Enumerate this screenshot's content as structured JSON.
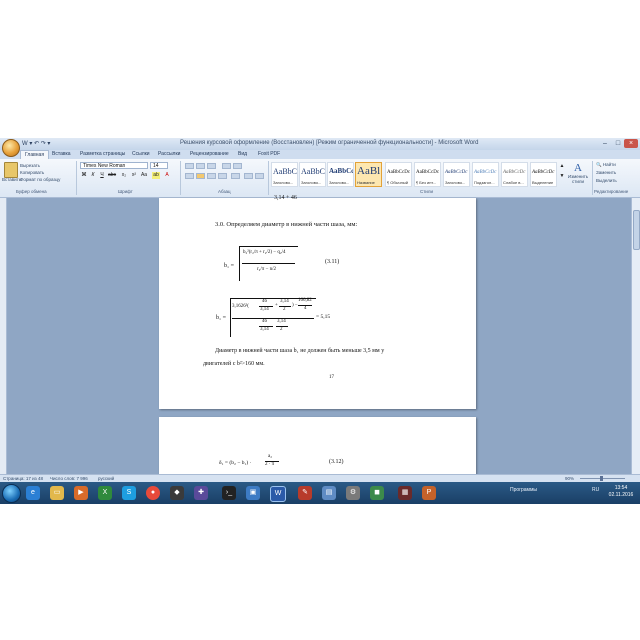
{
  "window": {
    "title": "Решения курсовой оформление (Восстановлен) [Режим ограниченной функциональности] - Microsoft Word",
    "qat": "W ▾ ↶ ↷ ▾"
  },
  "tabs": [
    "Главная",
    "Вставка",
    "Разметка страницы",
    "Ссылки",
    "Рассылки",
    "Рецензирование",
    "Вид",
    "Foxit PDF"
  ],
  "clipboard": {
    "paste": "Вставить",
    "cut": "Вырезать",
    "copy": "Копировать",
    "format_painter": "Формат по образцу",
    "group": "Буфер обмена"
  },
  "font": {
    "name": "Times New Roman",
    "size": "14",
    "group": "Шрифт"
  },
  "paragraph": {
    "group": "Абзац"
  },
  "styles": {
    "group": "Стили",
    "items": [
      {
        "sample": "AaBbCc",
        "name": "Заголово..."
      },
      {
        "sample": "AaBbC",
        "name": "Заголово..."
      },
      {
        "sample": "AaBbCc",
        "name": "Заголово..."
      },
      {
        "sample": "AaBl",
        "name": "Название"
      },
      {
        "sample": "AaBbCcDc",
        "name": "¶ Обычный"
      },
      {
        "sample": "AaBbCcDc",
        "name": "¶ Без инт..."
      },
      {
        "sample": "AaBbCcDc",
        "name": "Заголово..."
      },
      {
        "sample": "AaBbCcDc",
        "name": "Подзагол..."
      },
      {
        "sample": "AaBbCcDc",
        "name": "Слабое в..."
      },
      {
        "sample": "AaBbCcDc",
        "name": "Выделение"
      }
    ],
    "change": "Изменить стили"
  },
  "editing": {
    "find": "Найти",
    "replace": "Заменить",
    "select": "Выделить",
    "group": "Редактирование"
  },
  "document": {
    "top_fragment": "3,14 + 46",
    "section_heading": "3.0.   Определяем диаметр в нижней части шаза, мм:",
    "formula1_lhs": "b₁ =",
    "formula1_num": "b₂²(r₂/π + r₂/2) − q₂/4",
    "formula1_den": "r₂/π − n/2",
    "formula1_label": "(3.11)",
    "formula2_lhs": "b₁ =",
    "formula2_num_a": "3,1626²(",
    "formula2_num_b": "46",
    "formula2_num_c": "3,14",
    "formula2_num_d": "+",
    "formula2_num_e": "3,14",
    "formula2_num_f": "2",
    "formula2_num_g": ") −",
    "formula2_num_h": "166,82",
    "formula2_num_i": "4",
    "formula2_den_a": "46",
    "formula2_den_b": "3,14",
    "formula2_den_c": "3,14",
    "formula2_den_d": "2",
    "formula2_result": "= 5,15",
    "paragraph1": "Диаметр в нижней части шаза b₁ не должен быть меньше 3,5 мм у",
    "paragraph2": "двигателей с b²>160 мм.",
    "page_number": "17",
    "formula3_lhs": "δ₁ = (b₂ − b₁) ·",
    "formula3_num": "a₂",
    "formula3_den": "2 · π",
    "formula3_label": "(3.12)"
  },
  "statusbar": {
    "page": "Страница: 17 из 48",
    "words": "Число слов: 7 996",
    "lang": "русский",
    "zoom": "90%"
  },
  "taskbar": {
    "language": "RU",
    "tray_label": "Программы",
    "time": "13:54",
    "date": "02.11.2016"
  }
}
